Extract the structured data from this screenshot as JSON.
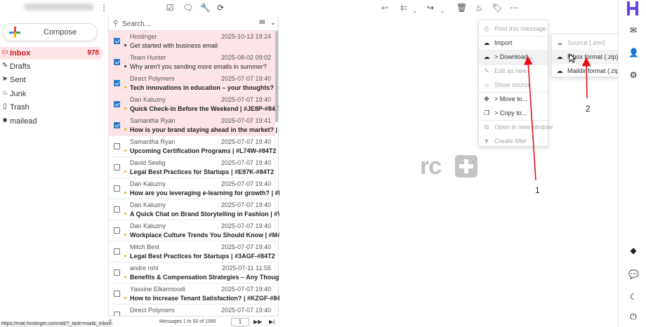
{
  "toolbar": {
    "icons": [
      "more-vert-icon",
      "check-square-icon",
      "chat-icon",
      "wrench-icon",
      "refresh-icon",
      "reply-icon",
      "reply-all-icon",
      "forward-icon",
      "trash-icon",
      "flame-icon",
      "tag-icon",
      "more-horiz-icon"
    ]
  },
  "compose": {
    "label": "Compose"
  },
  "folders": [
    {
      "label": "Inbox",
      "count": "978",
      "icon": "inbox-icon",
      "active": true
    },
    {
      "label": "Drafts",
      "count": "",
      "icon": "pencil-icon",
      "active": false
    },
    {
      "label": "Sent",
      "count": "",
      "icon": "send-icon",
      "active": false
    },
    {
      "label": "Junk",
      "count": "",
      "icon": "flame-icon",
      "active": false
    },
    {
      "label": "Trash",
      "count": "",
      "icon": "trash-icon",
      "active": false
    },
    {
      "label": "mailead",
      "count": "",
      "icon": "folder-icon",
      "active": false
    }
  ],
  "search": {
    "placeholder": "Search..."
  },
  "messages": [
    {
      "from": "Hostinger",
      "date": "2025-10-13 19:24",
      "subject": "Get started with business email",
      "selected": true,
      "unread": true,
      "bold": false
    },
    {
      "from": "Team Hunter",
      "date": "2025-08-02 09:02",
      "subject": "Why aren't you sending more emails in summer?",
      "selected": true,
      "unread": true,
      "bold": false
    },
    {
      "from": "Direct Polymers",
      "date": "2025-07-07 19:40",
      "subject": "Tech innovations in education – your thoughts? | #...",
      "selected": true,
      "unread": false,
      "bold": true
    },
    {
      "from": "Dan Kaluzny",
      "date": "2025-07-07 19:40",
      "subject": "Quick Check-in Before the Weekend | #JE8P-#84T2",
      "selected": true,
      "unread": false,
      "bold": true
    },
    {
      "from": "Samantha Ryan",
      "date": "2025-07-07 19:41",
      "subject": "How is your brand staying ahead in the market? | #...",
      "selected": true,
      "unread": false,
      "bold": true
    },
    {
      "from": "Samantha Ryan",
      "date": "2025-07-07 19:40",
      "subject": "Upcoming Certification Programs | #L74W-#84T2",
      "selected": false,
      "unread": false,
      "bold": true
    },
    {
      "from": "David Seelig",
      "date": "2025-07-07 19:40",
      "subject": "Legal Best Practices for Startups | #E97K-#84T2",
      "selected": false,
      "unread": false,
      "bold": true
    },
    {
      "from": "Dan Kaluzny",
      "date": "2025-07-07 19:40",
      "subject": "How are you leveraging e-learning for growth? | #B...",
      "selected": false,
      "unread": false,
      "bold": true
    },
    {
      "from": "Dan Kaluzny",
      "date": "2025-07-07 19:40",
      "subject": "A Quick Chat on Brand Storytelling in Fashion | #V7...",
      "selected": false,
      "unread": false,
      "bold": true
    },
    {
      "from": "Dan Kaluzny",
      "date": "2025-07-07 19:40",
      "subject": "Workplace Culture Trends You Should Know | #M4...",
      "selected": false,
      "unread": false,
      "bold": true
    },
    {
      "from": "Mitch Best",
      "date": "2025-07-07 19:40",
      "subject": "Legal Best Practices for Startups | #3AGF-#84T2",
      "selected": false,
      "unread": false,
      "bold": true
    },
    {
      "from": "andre rohl",
      "date": "2025-07-11 11:55",
      "subject": "Benefits & Compensation Strategies – Any Though...",
      "selected": false,
      "unread": false,
      "bold": true
    },
    {
      "from": "Yassine Elkarmoudi",
      "date": "2025-07-07 19:40",
      "subject": "How to Increase Tenant Satisfaction? | #KZGF-#84...",
      "selected": false,
      "unread": false,
      "bold": true
    },
    {
      "from": "Direct Polymers",
      "date": "2025-07-07 19:40",
      "subject": "",
      "selected": false,
      "unread": false,
      "bold": true
    }
  ],
  "list_footer": {
    "left": "4",
    "pagination": "Messages 1 to 50 of 1065",
    "page": "1"
  },
  "status_url": "https://mail.hostinger.com/old/?_task=mail&_mbox=INBOX#",
  "preview": {
    "logo_text": "rc"
  },
  "more_menu": [
    {
      "label": "Print this message",
      "icon": "printer-icon",
      "disabled": true
    },
    {
      "label": "Import",
      "icon": "cloud-upload-icon",
      "disabled": false
    },
    {
      "label": "> Download...",
      "icon": "cloud-download-icon",
      "disabled": false,
      "highlight": true
    },
    {
      "label": "Edit as new",
      "icon": "pencil-icon",
      "disabled": true
    },
    {
      "label": "Show source",
      "icon": "code-icon",
      "disabled": true
    },
    {
      "label": "> Move to...",
      "icon": "move-icon",
      "disabled": false
    },
    {
      "label": "> Copy to...",
      "icon": "copy-icon",
      "disabled": false
    },
    {
      "label": "Open in new window",
      "icon": "external-link-icon",
      "disabled": true
    },
    {
      "label": "Create filter",
      "icon": "filter-icon",
      "disabled": true
    }
  ],
  "download_menu": [
    {
      "label": "Source (.eml)",
      "icon": "cloud-download-icon",
      "disabled": true
    },
    {
      "label": "Mbox format (.zip)",
      "icon": "cloud-download-icon",
      "disabled": false,
      "highlight": true
    },
    {
      "label": "Maildir format (.zip)",
      "icon": "cloud-download-icon",
      "disabled": false
    }
  ],
  "annotations": {
    "step1": "1",
    "step2": "2",
    "arrow_color": "#e8101a"
  },
  "rail_icons": [
    "hostinger-logo-icon",
    "mail-icon",
    "user-icon",
    "gear-icon",
    "diamond-icon",
    "chat-bubbles-icon",
    "moon-icon",
    "power-icon"
  ],
  "colors": {
    "accent": "#d2161e",
    "selected_row": "#fde5e7",
    "brand": "#673de6"
  }
}
